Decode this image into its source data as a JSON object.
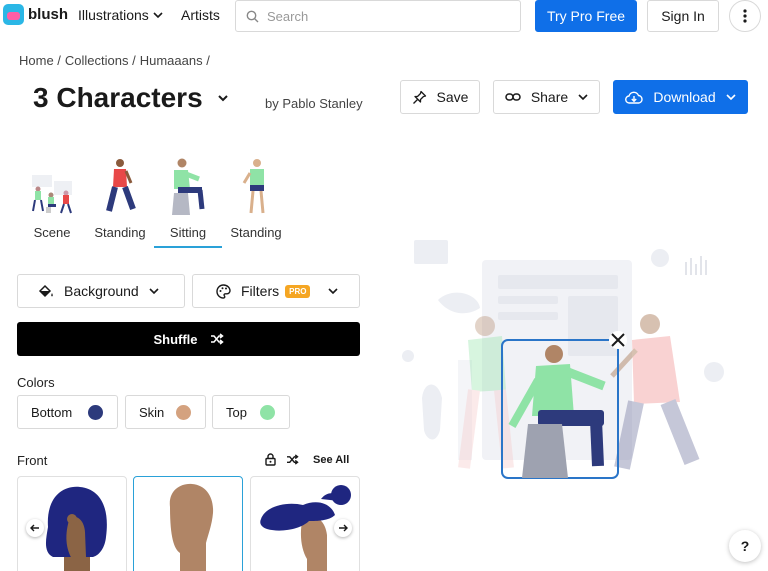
{
  "header": {
    "logo_text": "blush",
    "nav": [
      {
        "label": "Illustrations"
      },
      {
        "label": "Artists"
      }
    ],
    "search_placeholder": "Search",
    "try_pro_label": "Try Pro Free",
    "signin_label": "Sign In"
  },
  "breadcrumb": [
    "Home /",
    "Collections /",
    "Humaaans /"
  ],
  "page": {
    "title": "3 Characters",
    "author": "by Pablo Stanley",
    "save_label": "Save",
    "share_label": "Share",
    "download_label": "Download"
  },
  "poses": [
    {
      "label": "Scene",
      "active": false
    },
    {
      "label": "Standing",
      "active": false
    },
    {
      "label": "Sitting",
      "active": true
    },
    {
      "label": "Standing",
      "active": false
    }
  ],
  "controls": {
    "background_label": "Background",
    "filters_label": "Filters",
    "pro_badge": "PRO",
    "shuffle_label": "Shuffle"
  },
  "colors": {
    "label": "Colors",
    "items": [
      {
        "label": "Bottom",
        "color": "#2d3a7c"
      },
      {
        "label": "Skin",
        "color": "#d4a27f"
      },
      {
        "label": "Top",
        "color": "#8fe3a6"
      }
    ]
  },
  "front": {
    "label": "Front",
    "see_all_label": "See All"
  },
  "accent_colors": {
    "primary": "#0f6fe8",
    "selection": "#2aa1d8"
  },
  "help_label": "?"
}
